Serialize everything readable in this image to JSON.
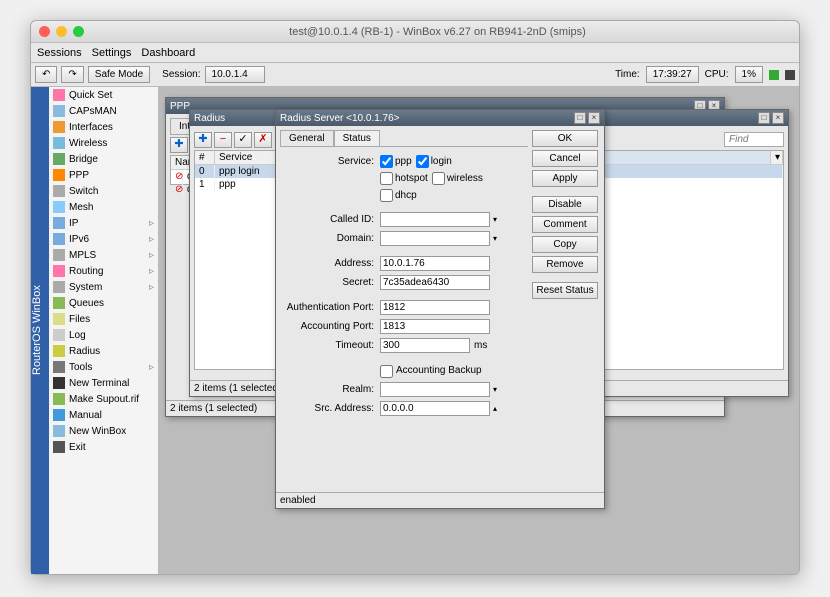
{
  "window": {
    "title": "test@10.0.1.4 (RB-1) - WinBox v6.27 on RB941-2nD (smips)"
  },
  "menubar": [
    "Sessions",
    "Settings",
    "Dashboard"
  ],
  "toolbar": {
    "safe_mode": "Safe Mode",
    "session_label": "Session:",
    "session_value": "10.0.1.4",
    "time_label": "Time:",
    "time_value": "17:39:27",
    "cpu_label": "CPU:",
    "cpu_value": "1%"
  },
  "sidebar_label": "RouterOS WinBox",
  "nav": [
    {
      "label": "Quick Set"
    },
    {
      "label": "CAPsMAN"
    },
    {
      "label": "Interfaces"
    },
    {
      "label": "Wireless"
    },
    {
      "label": "Bridge"
    },
    {
      "label": "PPP"
    },
    {
      "label": "Switch"
    },
    {
      "label": "Mesh"
    },
    {
      "label": "IP",
      "sub": "▹"
    },
    {
      "label": "IPv6",
      "sub": "▹"
    },
    {
      "label": "MPLS",
      "sub": "▹"
    },
    {
      "label": "Routing",
      "sub": "▹"
    },
    {
      "label": "System",
      "sub": "▹"
    },
    {
      "label": "Queues"
    },
    {
      "label": "Files"
    },
    {
      "label": "Log"
    },
    {
      "label": "Radius"
    },
    {
      "label": "Tools",
      "sub": "▹"
    },
    {
      "label": "New Terminal"
    },
    {
      "label": "Make Supout.rif"
    },
    {
      "label": "Manual"
    },
    {
      "label": "New WinBox"
    },
    {
      "label": "Exit"
    }
  ],
  "ppp_window": {
    "title": "PPP",
    "tab": "Interfa",
    "status": "2 items (1 selected)"
  },
  "radius_list": {
    "title": "Radius",
    "find_placeholder": "Find",
    "columns": [
      "#",
      "Service"
    ],
    "rows": [
      {
        "num": "0",
        "service": "ppp login",
        "selected": true
      },
      {
        "num": "1",
        "service": "ppp",
        "selected": false
      }
    ],
    "status": "2 items (1 selected)"
  },
  "radius_dialog": {
    "title": "Radius Server <10.0.1.76>",
    "tabs": [
      "General",
      "Status"
    ],
    "labels": {
      "service": "Service:",
      "called_id": "Called ID:",
      "domain": "Domain:",
      "address": "Address:",
      "secret": "Secret:",
      "auth_port": "Authentication Port:",
      "acct_port": "Accounting Port:",
      "timeout": "Timeout:",
      "timeout_unit": "ms",
      "acct_backup": "Accounting Backup",
      "realm": "Realm:",
      "src_address": "Src. Address:"
    },
    "services": {
      "ppp": {
        "label": "ppp",
        "checked": true
      },
      "login": {
        "label": "login",
        "checked": true
      },
      "hotspot": {
        "label": "hotspot",
        "checked": false
      },
      "wireless": {
        "label": "wireless",
        "checked": false
      },
      "dhcp": {
        "label": "dhcp",
        "checked": false
      }
    },
    "values": {
      "address": "10.0.1.76",
      "secret": "7c35adea6430",
      "auth_port": "1812",
      "acct_port": "1813",
      "timeout": "300",
      "src_address": "0.0.0.0",
      "called_id": "",
      "domain": "",
      "realm": ""
    },
    "buttons": {
      "ok": "OK",
      "cancel": "Cancel",
      "apply": "Apply",
      "disable": "Disable",
      "comment": "Comment",
      "copy": "Copy",
      "remove": "Remove",
      "reset_status": "Reset Status"
    },
    "status": "enabled"
  }
}
